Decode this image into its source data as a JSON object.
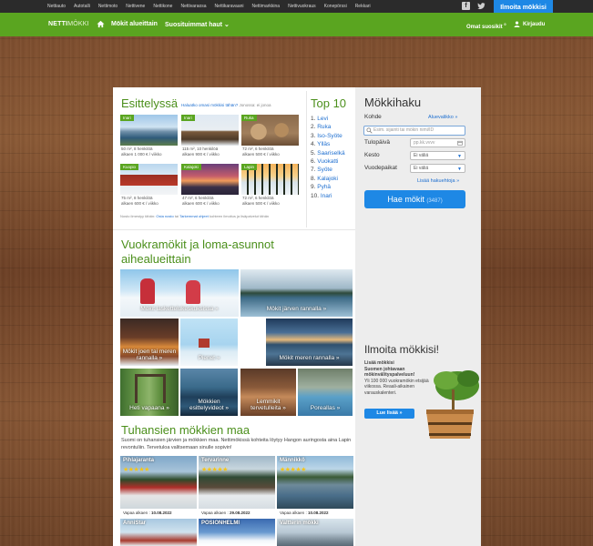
{
  "topbar": {
    "links": [
      "Nettiauto",
      "Autotalli",
      "Nettimoto",
      "Nettivene",
      "Nettikone",
      "Nettivaraosa",
      "Nettikaravaani",
      "Nettimarkkina",
      "Nettivuokraus",
      "Konepörssi",
      "Rekkari"
    ],
    "ilmoita_label": "Ilmoita mökkisi"
  },
  "header": {
    "logo_bold": "NETTI",
    "logo_thin": "MÖKKI",
    "nav": [
      "Mökit alueittain",
      "Suosituimmat haut ⌄"
    ],
    "omat_label": "Omat suosikit",
    "omat_count": "0",
    "login_label": "Kirjaudu"
  },
  "featured": {
    "title": "Esittelyssä",
    "subtitle_link": "Haluatko omasi mökkisi tähän?",
    "subtitle_rest": " Jonossa: ei jonoa",
    "items": [
      {
        "tag": "Inari",
        "desc": "50 m², 8 henkilöä",
        "price": "alkaen 1 000 € / viikko"
      },
      {
        "tag": "Inari",
        "desc": "115 m², 10 henkilöä",
        "price": "alkaen 900 € / viikko"
      },
      {
        "tag": "Ruka",
        "desc": "72 m², 6 henkilöä",
        "price": "alkaen 500 € / viikko"
      },
      {
        "tag": "Kuopio",
        "desc": "75 m², 8 henkilöä",
        "price": "alkaen 600 € / viikko"
      },
      {
        "tag": "Kalajoki",
        "desc": "47 m², 6 henkilöä",
        "price": "alkaen 600 € / viikko"
      },
      {
        "tag": "Lapin",
        "desc": "72 m², 6 henkilöä",
        "price": "alkaen 500 € / viikko"
      }
    ],
    "note_pre": "Nosto ilmestyy tähän: ",
    "note_link1": "Osta nosto",
    "note_mid": " tai ",
    "note_link2": "Tarkemmat ohjeet",
    "note_rest": " kohteen ilmoitus ja lisäpalvelut tähän"
  },
  "top10": {
    "title": "Top 10",
    "items": [
      "Levi",
      "Ruka",
      "Iso-Syöte",
      "Ylläs",
      "Saariselkä",
      "Vuokatti",
      "Syöte",
      "Kalajoki",
      "Pyhä",
      "Inari"
    ]
  },
  "search": {
    "title": "Mökkihaku",
    "kohde_label": "Kohde",
    "aluevalikko": "Aluevalikko »",
    "placeholder": "Esim. sijainti tai mökin nimi/ID",
    "tulopaiva_label": "Tulopäivä",
    "date_placeholder": "pp.kk.vvvv",
    "kesto_label": "Kesto",
    "kesto_value": "Ei väliä",
    "vuodepaikat_label": "Vuodepaikat",
    "vuodepaikat_value": "Ei väliä",
    "more_link": "Lisää hakuehtoja »",
    "button_label": "Hae mökit",
    "button_count": "(3487)"
  },
  "categories": {
    "title": "Vuokramökit ja loma-asunnot aihealueittain",
    "tiles": [
      "Mökit laskettelukeskuksissa »",
      "Mökit järven rannalla »",
      "Mökit joen tai meren rannalla »",
      "Pienet »",
      "Mökit meren rannalla »",
      "Heti vapaana »",
      "Mökkien esittelyvideot »",
      "Lemmikit tervetulleita »",
      "Poreallas »"
    ]
  },
  "about": {
    "title": "Tuhansien mökkien maa",
    "text": "Suomi on tuhansien järvien ja mökkien maa. Nettimökissä kohteita löytyy Hangon auringosta aina Lapin revontuliin. Tervetuloa valitsemaan sinulle sopivin!"
  },
  "cards": [
    {
      "name": "Pihlajaranta",
      "stars": "★★★★★",
      "avail_label": "Vapaa alkaen : ",
      "avail_date": "10.08.2022"
    },
    {
      "name": "Tervarinne",
      "stars": "★★★★★",
      "avail_label": "Vapaa alkaen : ",
      "avail_date": "29.08.2022"
    },
    {
      "name": "Männikkö",
      "stars": "★★★★★",
      "avail_label": "Vapaa alkaen : ",
      "avail_date": "10.08.2022"
    },
    {
      "name": "AnniStar",
      "stars": "",
      "avail_label": "",
      "avail_date": ""
    },
    {
      "name": "POSIONHELMI",
      "stars": "",
      "avail_label": "",
      "avail_date": ""
    },
    {
      "name": "Valtterin mökki",
      "stars": "",
      "avail_label": "",
      "avail_date": ""
    }
  ],
  "promo": {
    "title": "Ilmoita mökkisi!",
    "line1": "Lisää mökkisi",
    "line2": "Suomen johtavaan mökinvälityspalveluun!",
    "line3": "Yli 100 000 vuokramökin etsijää viikossa. Reaali-aikainen varauskalenteri.",
    "button": "Lue lisää »"
  },
  "colors": {
    "brand_green": "#5aa520",
    "title_green": "#4b8f1b",
    "accent_blue": "#1e88e5"
  }
}
